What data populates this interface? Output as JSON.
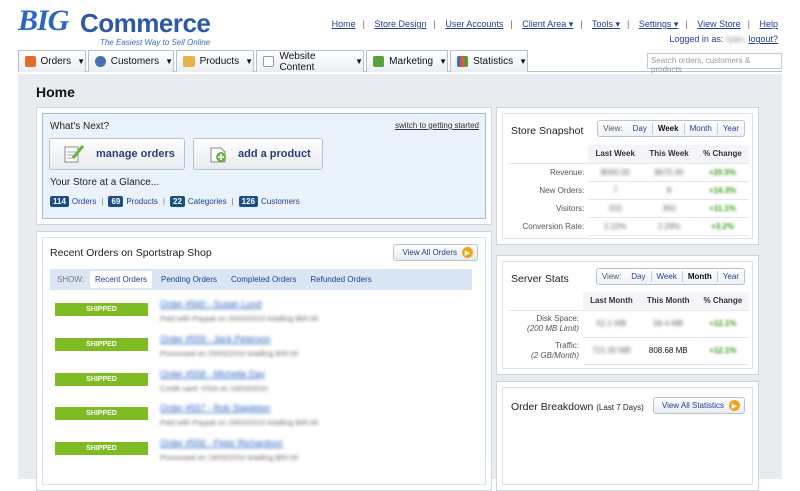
{
  "header": {
    "logo_big": "BIG",
    "logo_commerce": "Commerce",
    "tagline": "The Easiest Way to Sell Online",
    "links": [
      "Home",
      "Store Design",
      "User Accounts",
      "Client Area ▾",
      "Tools ▾",
      "Settings ▾",
      "View Store",
      "Help"
    ],
    "logged_in_label": "Logged in as:",
    "logged_in_user": "ryan,",
    "logout": "logout?"
  },
  "nav": {
    "tabs": [
      "Orders",
      "Customers",
      "Products",
      "Website Content",
      "Marketing",
      "Statistics"
    ],
    "search_placeholder": "Search orders, customers & products"
  },
  "page": {
    "title": "Home"
  },
  "whats_next": {
    "heading": "What's Next?",
    "switch_link": "switch to getting started",
    "manage_orders": "manage orders",
    "add_product": "add a product",
    "glance": "Your Store at a Glance...",
    "counts": [
      {
        "value": "114",
        "label": "Orders"
      },
      {
        "value": "69",
        "label": "Products"
      },
      {
        "value": "22",
        "label": "Categories"
      },
      {
        "value": "126",
        "label": "Customers"
      }
    ]
  },
  "recent_orders": {
    "heading": "Recent Orders on Sportstrap Shop",
    "view_all": "View All Orders",
    "show_label": "SHOW:",
    "filters": [
      "Recent Orders",
      "Pending Orders",
      "Completed Orders",
      "Refunded Orders"
    ],
    "orders": [
      {
        "status": "SHIPPED",
        "link": "Order #560 - Susan Lund",
        "detail": "Paid with Paypal on 20/03/2010 totalling $60.00"
      },
      {
        "status": "SHIPPED",
        "link": "Order #559 - Jack Peterson",
        "detail": "Processed on 20/03/2010 totalling $35.00"
      },
      {
        "status": "SHIPPED",
        "link": "Order #558 - Michelle Day",
        "detail": "Credit card: VISA on 19/03/2010"
      },
      {
        "status": "SHIPPED",
        "link": "Order #557 - Rob Stapleton",
        "detail": "Paid with Paypal on 19/03/2010 totalling $45.00"
      },
      {
        "status": "SHIPPED",
        "link": "Order #556 - Peter Richardson",
        "detail": "Processed on 18/03/2010 totalling $50.00"
      }
    ]
  },
  "snapshot": {
    "heading": "Store Snapshot",
    "view_label": "View:",
    "periods": [
      "Day",
      "Week",
      "Month",
      "Year"
    ],
    "selected": "Week",
    "columns": [
      "Last Week",
      "This Week",
      "% Change"
    ],
    "rows": [
      {
        "label": "Revenue:",
        "last": "$560.00",
        "this": "$675.00",
        "change": "+20.5%"
      },
      {
        "label": "New Orders:",
        "last": "7",
        "this": "8",
        "change": "+14.3%"
      },
      {
        "label": "Visitors:",
        "last": "315",
        "this": "350",
        "change": "+11.1%"
      },
      {
        "label": "Conversion Rate:",
        "last": "2.22%",
        "this": "2.29%",
        "change": "+3.2%"
      }
    ]
  },
  "server_stats": {
    "heading": "Server Stats",
    "view_label": "View:",
    "periods": [
      "Day",
      "Week",
      "Month",
      "Year"
    ],
    "selected": "Month",
    "columns": [
      "Last Month",
      "This Month",
      "% Change"
    ],
    "rows": [
      {
        "label": "Disk Space:",
        "sub": "(200 MB Limit)",
        "last": "52.1 MB",
        "this": "58.4 MB",
        "change": "+12.1%"
      },
      {
        "label": "Traffic:",
        "sub": "(2 GB/Month)",
        "last": "721.30 MB",
        "this": "808.68 MB",
        "change": "+12.1%"
      }
    ]
  },
  "order_breakdown": {
    "heading": "Order Breakdown",
    "sub": "(Last 7 Days)",
    "view_all": "View All Statistics"
  }
}
